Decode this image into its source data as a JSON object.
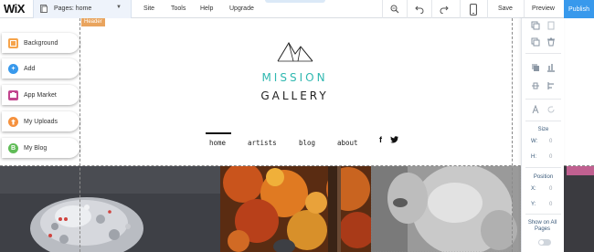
{
  "topbar": {
    "logo": "WiX",
    "pages_label": "Pages: home",
    "menu": [
      "Site",
      "Tools",
      "Help",
      "Upgrade"
    ],
    "icons": [
      "zoom-icon",
      "undo-icon",
      "redo-icon",
      "mobile-icon"
    ],
    "save_label": "Save",
    "preview_label": "Preview",
    "publish_label": "Publish"
  },
  "canvas": {
    "header_tag": "Header",
    "site_title_line1": "MISSION",
    "site_title_line2": "GALLERY",
    "nav": [
      "home",
      "artists",
      "blog",
      "about"
    ],
    "social": [
      "f",
      "🐦"
    ]
  },
  "left_panel": {
    "items": [
      {
        "label": "Background",
        "icon": "background-icon",
        "color": "#f6a44b"
      },
      {
        "label": "Add",
        "icon": "add-icon",
        "color": "#3899ec"
      },
      {
        "label": "App Market",
        "icon": "app-market-icon",
        "color": "#c2458e"
      },
      {
        "label": "My Uploads",
        "icon": "uploads-icon",
        "color": "#f5913e"
      },
      {
        "label": "My Blog",
        "icon": "blog-icon",
        "color": "#60bc57"
      }
    ]
  },
  "right_panel": {
    "size_label": "Size",
    "w_label": "W:",
    "w_value": "0",
    "h_label": "H:",
    "h_value": "0",
    "position_label": "Position",
    "x_label": "X:",
    "x_value": "0",
    "y_label": "Y:",
    "y_value": "0",
    "show_on_all_line1": "Show on All",
    "show_on_all_line2": "Pages"
  },
  "colors": {
    "accent": "#3899ec",
    "teal_title": "#2fb8b0",
    "header_tag": "#e9a45e"
  }
}
